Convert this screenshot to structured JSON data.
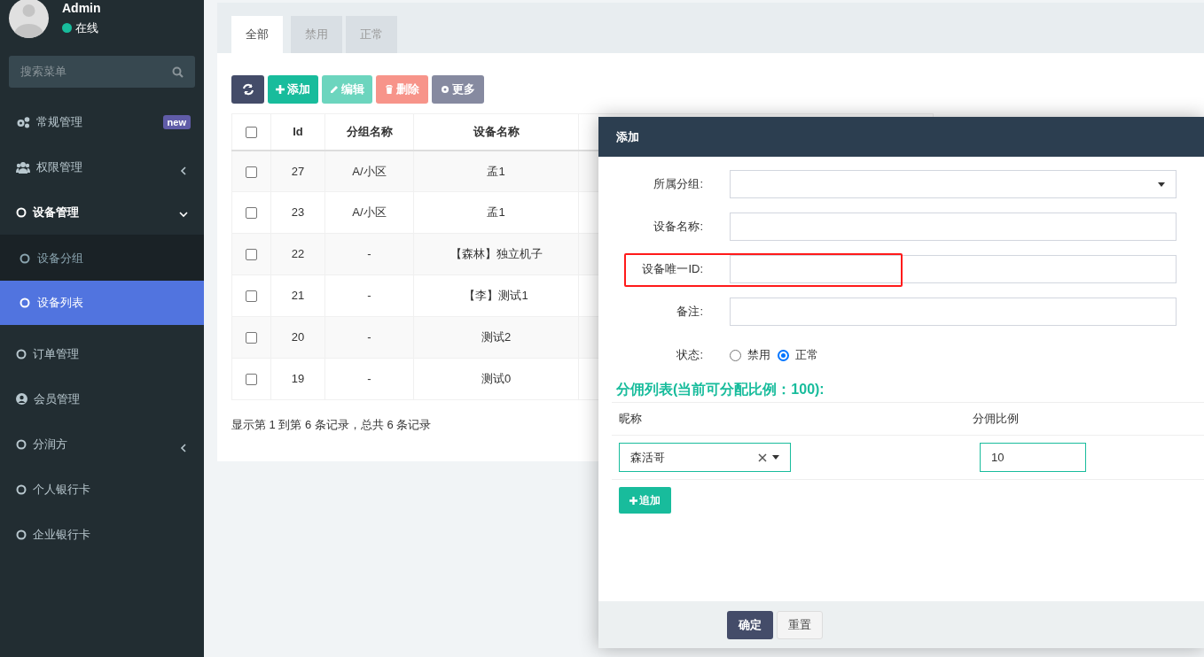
{
  "user": {
    "name": "Admin",
    "status": "在线"
  },
  "sidebar": {
    "search": {
      "placeholder": "搜索菜单"
    },
    "items": [
      {
        "label": "常规管理",
        "kind": "gears",
        "badge": "new"
      },
      {
        "label": "权限管理",
        "kind": "users",
        "expanded": false
      },
      {
        "label": "设备管理",
        "kind": "circle",
        "expanded": true,
        "children": [
          {
            "label": "设备分组",
            "selected": false
          },
          {
            "label": "设备列表",
            "selected": true
          }
        ]
      },
      {
        "label": "订单管理",
        "kind": "circle"
      },
      {
        "label": "会员管理",
        "kind": "user-circle"
      },
      {
        "label": "分润方",
        "kind": "circle",
        "expanded": false
      },
      {
        "label": "个人银行卡",
        "kind": "circle"
      },
      {
        "label": "企业银行卡",
        "kind": "circle"
      }
    ]
  },
  "tabs": [
    {
      "label": "全部",
      "selected": true
    },
    {
      "label": "禁用",
      "selected": false
    },
    {
      "label": "正常",
      "selected": false
    }
  ],
  "toolbar": [
    {
      "kind": "refresh"
    },
    {
      "kind": "add",
      "label": "添加"
    },
    {
      "kind": "edit",
      "label": "编辑"
    },
    {
      "kind": "delete",
      "label": "删除"
    },
    {
      "kind": "more",
      "label": "更多"
    }
  ],
  "table": {
    "all_checked": false,
    "columns": [
      "Id",
      "分组名称",
      "设备名称"
    ],
    "rows": [
      {
        "checked": false,
        "cells": [
          "27",
          "A/小区",
          "孟1"
        ]
      },
      {
        "checked": false,
        "cells": [
          "23",
          "A/小区",
          "孟1"
        ]
      },
      {
        "checked": false,
        "cells": [
          "22",
          "-",
          "【森林】独立机子"
        ]
      },
      {
        "checked": false,
        "cells": [
          "21",
          "-",
          "【李】测试1"
        ]
      },
      {
        "checked": false,
        "cells": [
          "20",
          "-",
          "测试2"
        ]
      },
      {
        "checked": false,
        "cells": [
          "19",
          "-",
          "测试0"
        ]
      }
    ]
  },
  "pagination_info": "显示第 1 到第 6 条记录，总共 6 条记录",
  "dialog": {
    "title": "添加",
    "fields": [
      {
        "kind": "select",
        "label": "所属分组:",
        "highlighted": false
      },
      {
        "kind": "text",
        "label": "设备名称:",
        "highlighted": false
      },
      {
        "kind": "text",
        "label": "设备唯一ID:",
        "highlighted": true
      },
      {
        "kind": "text",
        "label": "备注:",
        "highlighted": false
      }
    ],
    "status": {
      "label": "状态:",
      "options": [
        {
          "label": "禁用",
          "selected": false
        },
        {
          "label": "正常",
          "selected": true
        }
      ]
    },
    "commission": {
      "heading": "分佣列表(当前可分配比例：100):",
      "columns": [
        "昵称",
        "分佣比例"
      ],
      "rows": [
        {
          "nickname": "森活哥",
          "ratio": "10"
        }
      ],
      "add_button": "追加"
    },
    "buttons": [
      {
        "kind": "primary",
        "label": "确定"
      },
      {
        "kind": "default",
        "label": "重置"
      }
    ]
  }
}
